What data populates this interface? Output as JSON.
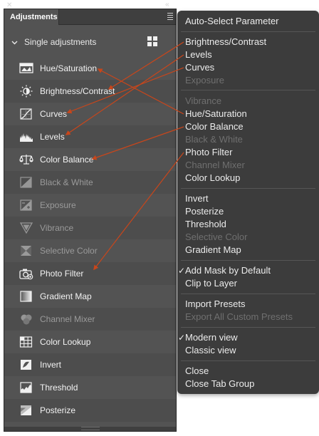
{
  "panel": {
    "tab_label": "Adjustments",
    "section_label": "Single adjustments",
    "items": [
      {
        "label": "Hue/Saturation",
        "icon": "hue-saturation-icon",
        "disabled": false
      },
      {
        "label": "Brightness/Contrast",
        "icon": "brightness-contrast-icon",
        "disabled": false
      },
      {
        "label": "Curves",
        "icon": "curves-icon",
        "disabled": false
      },
      {
        "label": "Levels",
        "icon": "levels-icon",
        "disabled": false
      },
      {
        "label": "Color Balance",
        "icon": "color-balance-icon",
        "disabled": false
      },
      {
        "label": "Black & White",
        "icon": "black-white-icon",
        "disabled": true
      },
      {
        "label": "Exposure",
        "icon": "exposure-icon",
        "disabled": true
      },
      {
        "label": "Vibrance",
        "icon": "vibrance-icon",
        "disabled": true
      },
      {
        "label": "Selective Color",
        "icon": "selective-color-icon",
        "disabled": true
      },
      {
        "label": "Photo Filter",
        "icon": "photo-filter-icon",
        "disabled": false
      },
      {
        "label": "Gradient Map",
        "icon": "gradient-map-icon",
        "disabled": false
      },
      {
        "label": "Channel Mixer",
        "icon": "channel-mixer-icon",
        "disabled": true
      },
      {
        "label": "Color Lookup",
        "icon": "color-lookup-icon",
        "disabled": false
      },
      {
        "label": "Invert",
        "icon": "invert-icon",
        "disabled": false
      },
      {
        "label": "Threshold",
        "icon": "threshold-icon",
        "disabled": false
      },
      {
        "label": "Posterize",
        "icon": "posterize-icon",
        "disabled": false
      }
    ]
  },
  "menu": {
    "items": [
      {
        "label": "Auto-Select Parameter",
        "disabled": false,
        "checked": false
      },
      {
        "label": "Brightness/Contrast",
        "disabled": false,
        "checked": false
      },
      {
        "label": "Levels",
        "disabled": false,
        "checked": false
      },
      {
        "label": "Curves",
        "disabled": false,
        "checked": false
      },
      {
        "label": "Exposure",
        "disabled": true,
        "checked": false
      },
      {
        "label": "Vibrance",
        "disabled": true,
        "checked": false
      },
      {
        "label": "Hue/Saturation",
        "disabled": false,
        "checked": false
      },
      {
        "label": "Color Balance",
        "disabled": false,
        "checked": false
      },
      {
        "label": "Black & White",
        "disabled": true,
        "checked": false
      },
      {
        "label": "Photo Filter",
        "disabled": false,
        "checked": false
      },
      {
        "label": "Channel Mixer",
        "disabled": true,
        "checked": false
      },
      {
        "label": "Color Lookup",
        "disabled": false,
        "checked": false
      },
      {
        "label": "Invert",
        "disabled": false,
        "checked": false
      },
      {
        "label": "Posterize",
        "disabled": false,
        "checked": false
      },
      {
        "label": "Threshold",
        "disabled": false,
        "checked": false
      },
      {
        "label": "Selective Color",
        "disabled": true,
        "checked": false
      },
      {
        "label": "Gradient Map",
        "disabled": false,
        "checked": false
      },
      {
        "label": "Add Mask by Default",
        "disabled": false,
        "checked": true
      },
      {
        "label": "Clip to Layer",
        "disabled": false,
        "checked": false
      },
      {
        "label": "Import Presets",
        "disabled": false,
        "checked": false
      },
      {
        "label": "Export All Custom Presets",
        "disabled": true,
        "checked": false
      },
      {
        "label": "Modern view",
        "disabled": false,
        "checked": true
      },
      {
        "label": "Classic view",
        "disabled": false,
        "checked": false
      },
      {
        "label": "Close",
        "disabled": false,
        "checked": false
      },
      {
        "label": "Close Tab Group",
        "disabled": false,
        "checked": false
      }
    ],
    "check_glyph": "✓"
  },
  "colors": {
    "panel_bg": "#535353",
    "menu_bg": "#3c3c3c",
    "annotation_arrow": "#c8461b"
  }
}
